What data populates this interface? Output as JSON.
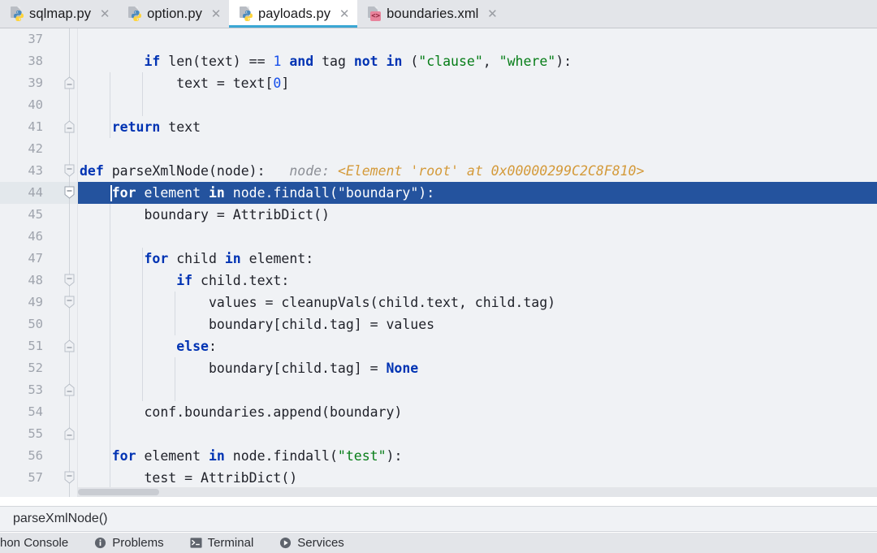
{
  "window": {
    "app": "PyCharm editor",
    "accent_active_tab_underline": "#3ba7d4",
    "selection_color": "#24539e",
    "editor_bg": "#f0f2f5"
  },
  "tabs": [
    {
      "label": "sqlmap.py",
      "icon": "python-file-icon",
      "active": false,
      "close": "✕"
    },
    {
      "label": "option.py",
      "icon": "python-file-icon",
      "active": false,
      "close": "✕"
    },
    {
      "label": "payloads.py",
      "icon": "python-file-icon",
      "active": true,
      "close": "✕"
    },
    {
      "label": "boundaries.xml",
      "icon": "xml-file-icon",
      "active": false,
      "close": "✕"
    }
  ],
  "editor": {
    "first_line_number": 37,
    "selected_line_number": 44,
    "line_numbers": [
      "37",
      "38",
      "39",
      "40",
      "41",
      "42",
      "43",
      "44",
      "45",
      "46",
      "47",
      "48",
      "49",
      "50",
      "51",
      "52",
      "53",
      "54",
      "55",
      "56",
      "57"
    ],
    "lines": [
      {
        "n": "37",
        "text": ""
      },
      {
        "n": "38",
        "text": "        if len(text) == 1 and tag not in (\"clause\", \"where\"):"
      },
      {
        "n": "39",
        "text": "            text = text[0]"
      },
      {
        "n": "40",
        "text": ""
      },
      {
        "n": "41",
        "text": "    return text"
      },
      {
        "n": "42",
        "text": ""
      },
      {
        "n": "43",
        "text": "def parseXmlNode(node):"
      },
      {
        "n": "44",
        "text": "    for element in node.findall(\"boundary\"):"
      },
      {
        "n": "45",
        "text": "        boundary = AttribDict()"
      },
      {
        "n": "46",
        "text": ""
      },
      {
        "n": "47",
        "text": "        for child in element:"
      },
      {
        "n": "48",
        "text": "            if child.text:"
      },
      {
        "n": "49",
        "text": "                values = cleanupVals(child.text, child.tag)"
      },
      {
        "n": "50",
        "text": "                boundary[child.tag] = values"
      },
      {
        "n": "51",
        "text": "            else:"
      },
      {
        "n": "52",
        "text": "                boundary[child.tag] = None"
      },
      {
        "n": "53",
        "text": ""
      },
      {
        "n": "54",
        "text": "        conf.boundaries.append(boundary)"
      },
      {
        "n": "55",
        "text": ""
      },
      {
        "n": "56",
        "text": "    for element in node.findall(\"test\"):"
      },
      {
        "n": "57",
        "text": "        test = AttribDict()"
      }
    ],
    "inline_hint": {
      "line": "43",
      "key": "node:",
      "value": "<Element 'root' at 0x00000299C2C8F810>"
    }
  },
  "breadcrumb": {
    "text": "parseXmlNode()"
  },
  "statusbar": {
    "items": [
      {
        "label": "hon Console",
        "icon": "none",
        "truncated": true
      },
      {
        "label": "Problems",
        "icon": "info-icon",
        "truncated": false
      },
      {
        "label": "Terminal",
        "icon": "terminal-icon",
        "truncated": false
      },
      {
        "label": "Services",
        "icon": "play-icon",
        "truncated": false
      }
    ]
  }
}
